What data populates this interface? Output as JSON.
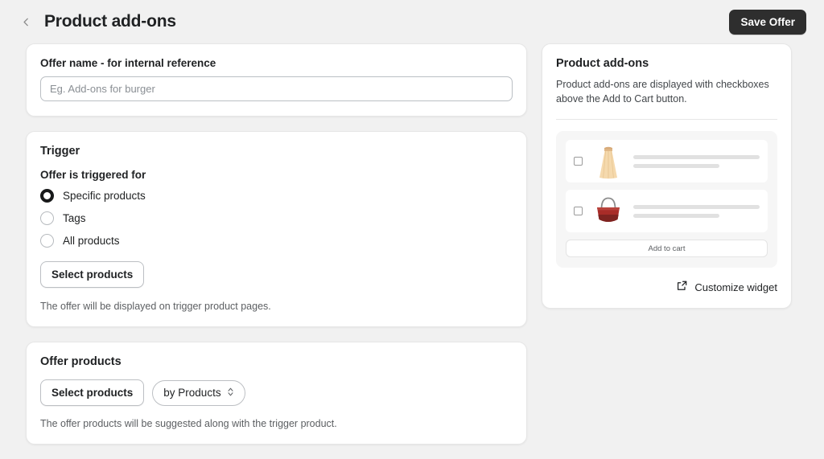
{
  "header": {
    "back_icon": "chevron-left-icon",
    "title": "Product add-ons",
    "save_label": "Save Offer"
  },
  "offer_name_card": {
    "label": "Offer name - for internal reference",
    "input_value": "",
    "input_placeholder": "Eg. Add-ons for burger"
  },
  "trigger_card": {
    "heading": "Trigger",
    "sub_label": "Offer is triggered for",
    "options": [
      {
        "label": "Specific products",
        "selected": true
      },
      {
        "label": "Tags",
        "selected": false
      },
      {
        "label": "All products",
        "selected": false
      }
    ],
    "select_products_label": "Select products",
    "help_text": "The offer will be displayed on trigger product pages."
  },
  "offer_products_card": {
    "heading": "Offer products",
    "select_products_label": "Select products",
    "select_by_value": "by Products",
    "select_by_icon": "chevron-up-down-icon",
    "help_text": "The offer products will be suggested along with the trigger product."
  },
  "preview_panel": {
    "title": "Product add-ons",
    "description": "Product add-ons are displayed with checkboxes above the Add to Cart button.",
    "items": [
      {
        "thumb": "dress-thumbnail",
        "checked": false
      },
      {
        "thumb": "handbag-thumbnail",
        "checked": false
      }
    ],
    "add_to_cart_label": "Add to cart",
    "customize_label": "Customize widget",
    "customize_icon": "external-link-icon"
  },
  "colors": {
    "page_background": "#f1f1f1",
    "card_background": "#ffffff",
    "primary_button": "#2e2e2e",
    "text_primary": "#202223",
    "text_secondary": "#5c5f62",
    "border": "#e6e6e6",
    "dress_color": "#f2d3a4",
    "bag_color": "#a82c28"
  }
}
